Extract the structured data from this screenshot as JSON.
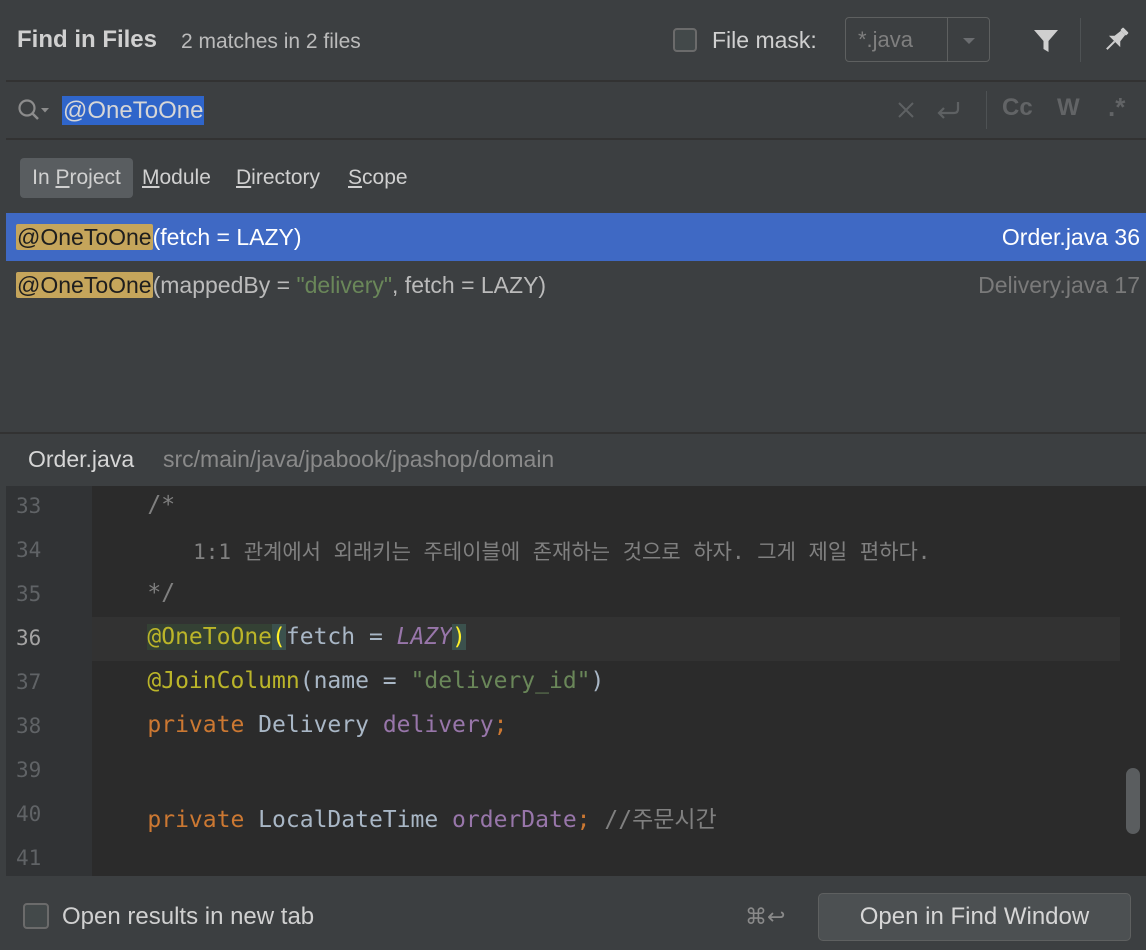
{
  "header": {
    "title": "Find in Files",
    "subtitle": "2 matches in 2 files",
    "file_mask_label": "File mask:",
    "file_mask_checked": false,
    "file_mask_value": "*.java"
  },
  "search": {
    "query": "@OneToOne",
    "case_label": "Cc",
    "word_label": "W",
    "regex_label": ".*"
  },
  "scopes": [
    {
      "mnemonic_pre": "In ",
      "mnemonic": "P",
      "rest": "roject",
      "active": true
    },
    {
      "mnemonic_pre": "",
      "mnemonic": "M",
      "rest": "odule",
      "active": false
    },
    {
      "mnemonic_pre": "",
      "mnemonic": "D",
      "rest": "irectory",
      "active": false
    },
    {
      "mnemonic_pre": "",
      "mnemonic": "S",
      "rest": "cope",
      "active": false
    }
  ],
  "results": [
    {
      "match": "@OneToOne",
      "rest": "(fetch = LAZY)",
      "file": "Order.java 36",
      "selected": true
    },
    {
      "match": "@OneToOne",
      "rest_pre": "(mappedBy = ",
      "string": "\"delivery\"",
      "rest_post": ", fetch = LAZY)",
      "file": "Delivery.java 17",
      "selected": false
    }
  ],
  "preview": {
    "file": "Order.java",
    "path": "src/main/java/jpabook/jpashop/domain",
    "current_line": 36,
    "line_numbers": [
      "33",
      "34",
      "35",
      "36",
      "37",
      "38",
      "39",
      "40",
      "41"
    ],
    "lines": {
      "l33": "    /*",
      "l34": "        1:1 관계에서 외래키는 주테이블에 존재하는 것으로 하자. 그게 제일 편하다.",
      "l35": "    */",
      "l36_indent": "    ",
      "l36_ann": "@OneToOne",
      "l36_open": "(",
      "l36_mid": "fetch = ",
      "l36_const": "LAZY",
      "l36_close": ")",
      "l37_indent": "    ",
      "l37_ann": "@JoinColumn",
      "l37_mid": "(name = ",
      "l37_str": "\"delivery_id\"",
      "l37_close": ")",
      "l38_indent": "    ",
      "l38_kw": "private",
      "l38_type": " Delivery ",
      "l38_field": "delivery",
      "l38_semi": ";",
      "l40_indent": "    ",
      "l40_kw": "private",
      "l40_type": " LocalDateTime ",
      "l40_field": "orderDate",
      "l40_semi": ";",
      "l40_comment": " //주문시간"
    }
  },
  "footer": {
    "new_tab_label": "Open results in new tab",
    "new_tab_checked": false,
    "shortcut": "⌘↩",
    "open_button": "Open in Find Window"
  },
  "colors": {
    "background": "#3c3f41",
    "selection": "#3f69c4",
    "match_highlight": "#c5a55b",
    "editor_bg": "#2b2b2b",
    "keyword": "#cc7832",
    "annotation": "#bbb529",
    "string": "#6a8759",
    "field": "#9876aa"
  }
}
